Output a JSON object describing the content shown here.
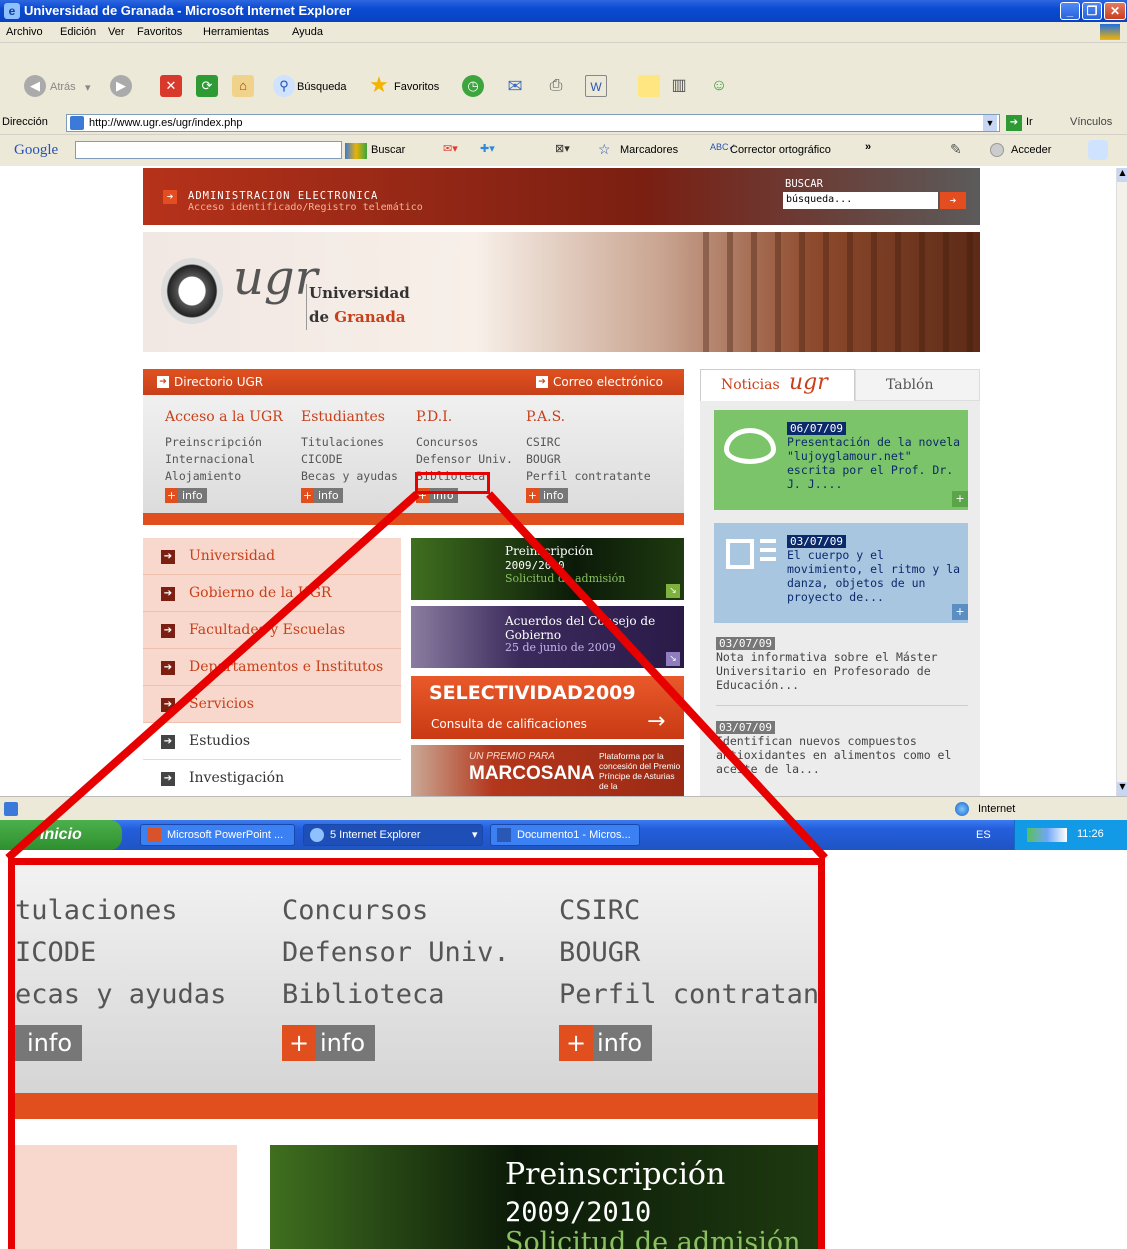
{
  "window": {
    "title": "Universidad de Granada - Microsoft Internet Explorer"
  },
  "menu": [
    "Archivo",
    "Edición",
    "Ver",
    "Favoritos",
    "Herramientas",
    "Ayuda"
  ],
  "toolbar": {
    "back": "Atrás",
    "search": "Búsqueda",
    "favorites": "Favoritos"
  },
  "address": {
    "label": "Dirección",
    "url": "http://www.ugr.es/ugr/index.php",
    "go": "Ir",
    "links": "Vínculos"
  },
  "google_bar": {
    "logo": "Google",
    "buscar": "Buscar",
    "marcadores": "Marcadores",
    "corrector": "Corrector ortográfico",
    "acceder": "Acceder"
  },
  "page": {
    "admin_title": "ADMINISTRACION ELECTRONICA",
    "admin_sub": "Acceso identificado/Registro telemático",
    "buscar_label": "BUSCAR",
    "search_value": "búsqueda...",
    "logo_text": "ugr",
    "uni_line1": "Universidad",
    "uni_line2_de": "de",
    "uni_line2_granada": "Granada",
    "directorio": "Directorio UGR",
    "correo": "Correo electrónico",
    "columns": [
      {
        "title": "Acceso a la UGR",
        "items": [
          "Preinscripción",
          "Internacional",
          "Alojamiento"
        ]
      },
      {
        "title": "Estudiantes",
        "items": [
          "Titulaciones",
          "CICODE",
          "Becas y ayudas"
        ]
      },
      {
        "title": "P.D.I.",
        "items": [
          "Concursos",
          "Defensor Univ.",
          "Biblioteca"
        ]
      },
      {
        "title": "P.A.S.",
        "items": [
          "CSIRC",
          "BOUGR",
          "Perfil contratante"
        ]
      }
    ],
    "info_label": "info",
    "info_plus": "+",
    "nav": [
      "Universidad",
      "Gobierno de la UGR",
      "Facultades y Escuelas",
      "Departamentos e Institutos",
      "Servicios",
      "Estudios",
      "Investigación"
    ],
    "promo1": {
      "title1": "Preinscripción",
      "title2": "2009/2010",
      "sub": "Solicitud de admisión"
    },
    "promo2": {
      "title1": "Acuerdos del Consejo de",
      "title2": "Gobierno",
      "sub": "25 de junio de 2009"
    },
    "promo3": {
      "title": "SELECTIVIDAD2009",
      "sub": "Consulta de calificaciones"
    },
    "promo4": {
      "kicker": "UN PREMIO PARA",
      "name": "MARCOSANA",
      "side": "Plataforma por la concesión del Premio Príncipe de Asturias de la"
    },
    "news_tab": "Noticias",
    "news_tab_logo": "ugr",
    "tablon_tab": "Tablón",
    "news": [
      {
        "date": "06/07/09",
        "text": "Presentación de la novela \"lujoyglamour.net\" escrita por el Prof. Dr. J. J...."
      },
      {
        "date": "03/07/09",
        "text": "El cuerpo y el movimiento, el ritmo y la danza, objetos de un proyecto de..."
      },
      {
        "date": "03/07/09",
        "text": "Nota informativa sobre el Máster Universitario en Profesorado de Educación..."
      },
      {
        "date": "03/07/09",
        "text": "Identifican nuevos compuestos antioxidantes en alimentos como el aceite de la..."
      }
    ]
  },
  "statusbar": {
    "zone": "Internet"
  },
  "taskbar": {
    "start": "Inicio",
    "tasks": [
      "Microsoft PowerPoint ...",
      "5 Internet Explorer",
      "Documento1 - Micros..."
    ],
    "lang": "ES",
    "clock": "11:26"
  },
  "zoom": {
    "col2": [
      "tulaciones",
      "ICODE",
      "ecas y ayudas"
    ],
    "col3": [
      "Concursos",
      "Defensor Univ.",
      "Biblioteca"
    ],
    "col4": [
      "CSIRC",
      "BOUGR",
      "Perfil contratante"
    ],
    "info": "info",
    "plus": "+",
    "promo_title1": "Preinscripción",
    "promo_title2": "2009/2010",
    "promo_sub": "Solicitud de admisión"
  }
}
